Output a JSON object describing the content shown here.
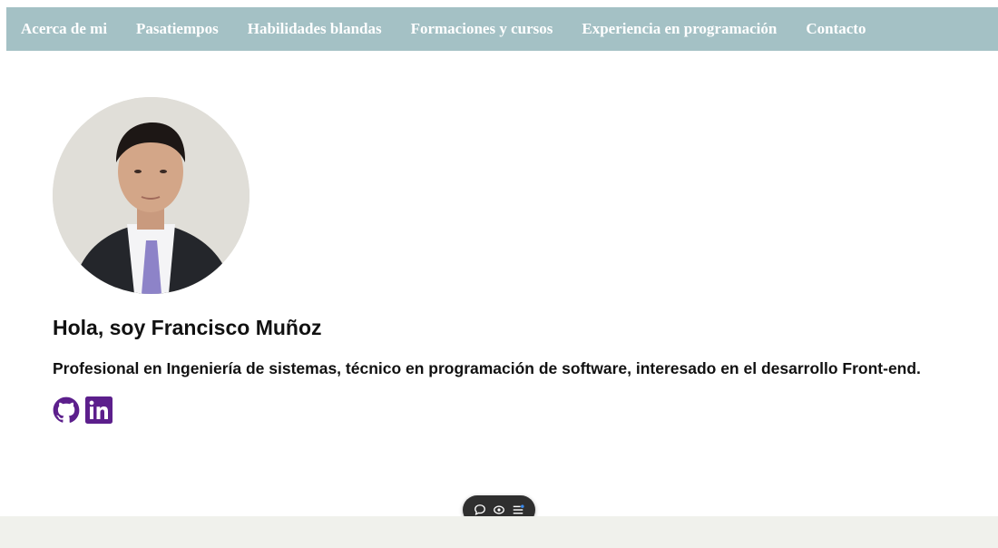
{
  "nav": {
    "items": [
      {
        "label": "Acerca de mi"
      },
      {
        "label": "Pasatiempos"
      },
      {
        "label": "Habilidades blandas"
      },
      {
        "label": "Formaciones y cursos"
      },
      {
        "label": "Experiencia en programación"
      },
      {
        "label": "Contacto"
      }
    ]
  },
  "profile": {
    "greeting": "Hola, soy Francisco Muñoz",
    "bio": "Profesional en Ingeniería de sistemas, técnico en programación de software, interesado en el desarrollo Front-end."
  },
  "social": {
    "icons": [
      "github-icon",
      "linkedin-icon"
    ],
    "color": "#5c1f8c"
  },
  "toolbar": {
    "icons": [
      "comment-icon",
      "eye-icon",
      "menu-icon"
    ]
  },
  "colors": {
    "navbar": "#a4c1c5",
    "footer": "#f0f1ec"
  }
}
